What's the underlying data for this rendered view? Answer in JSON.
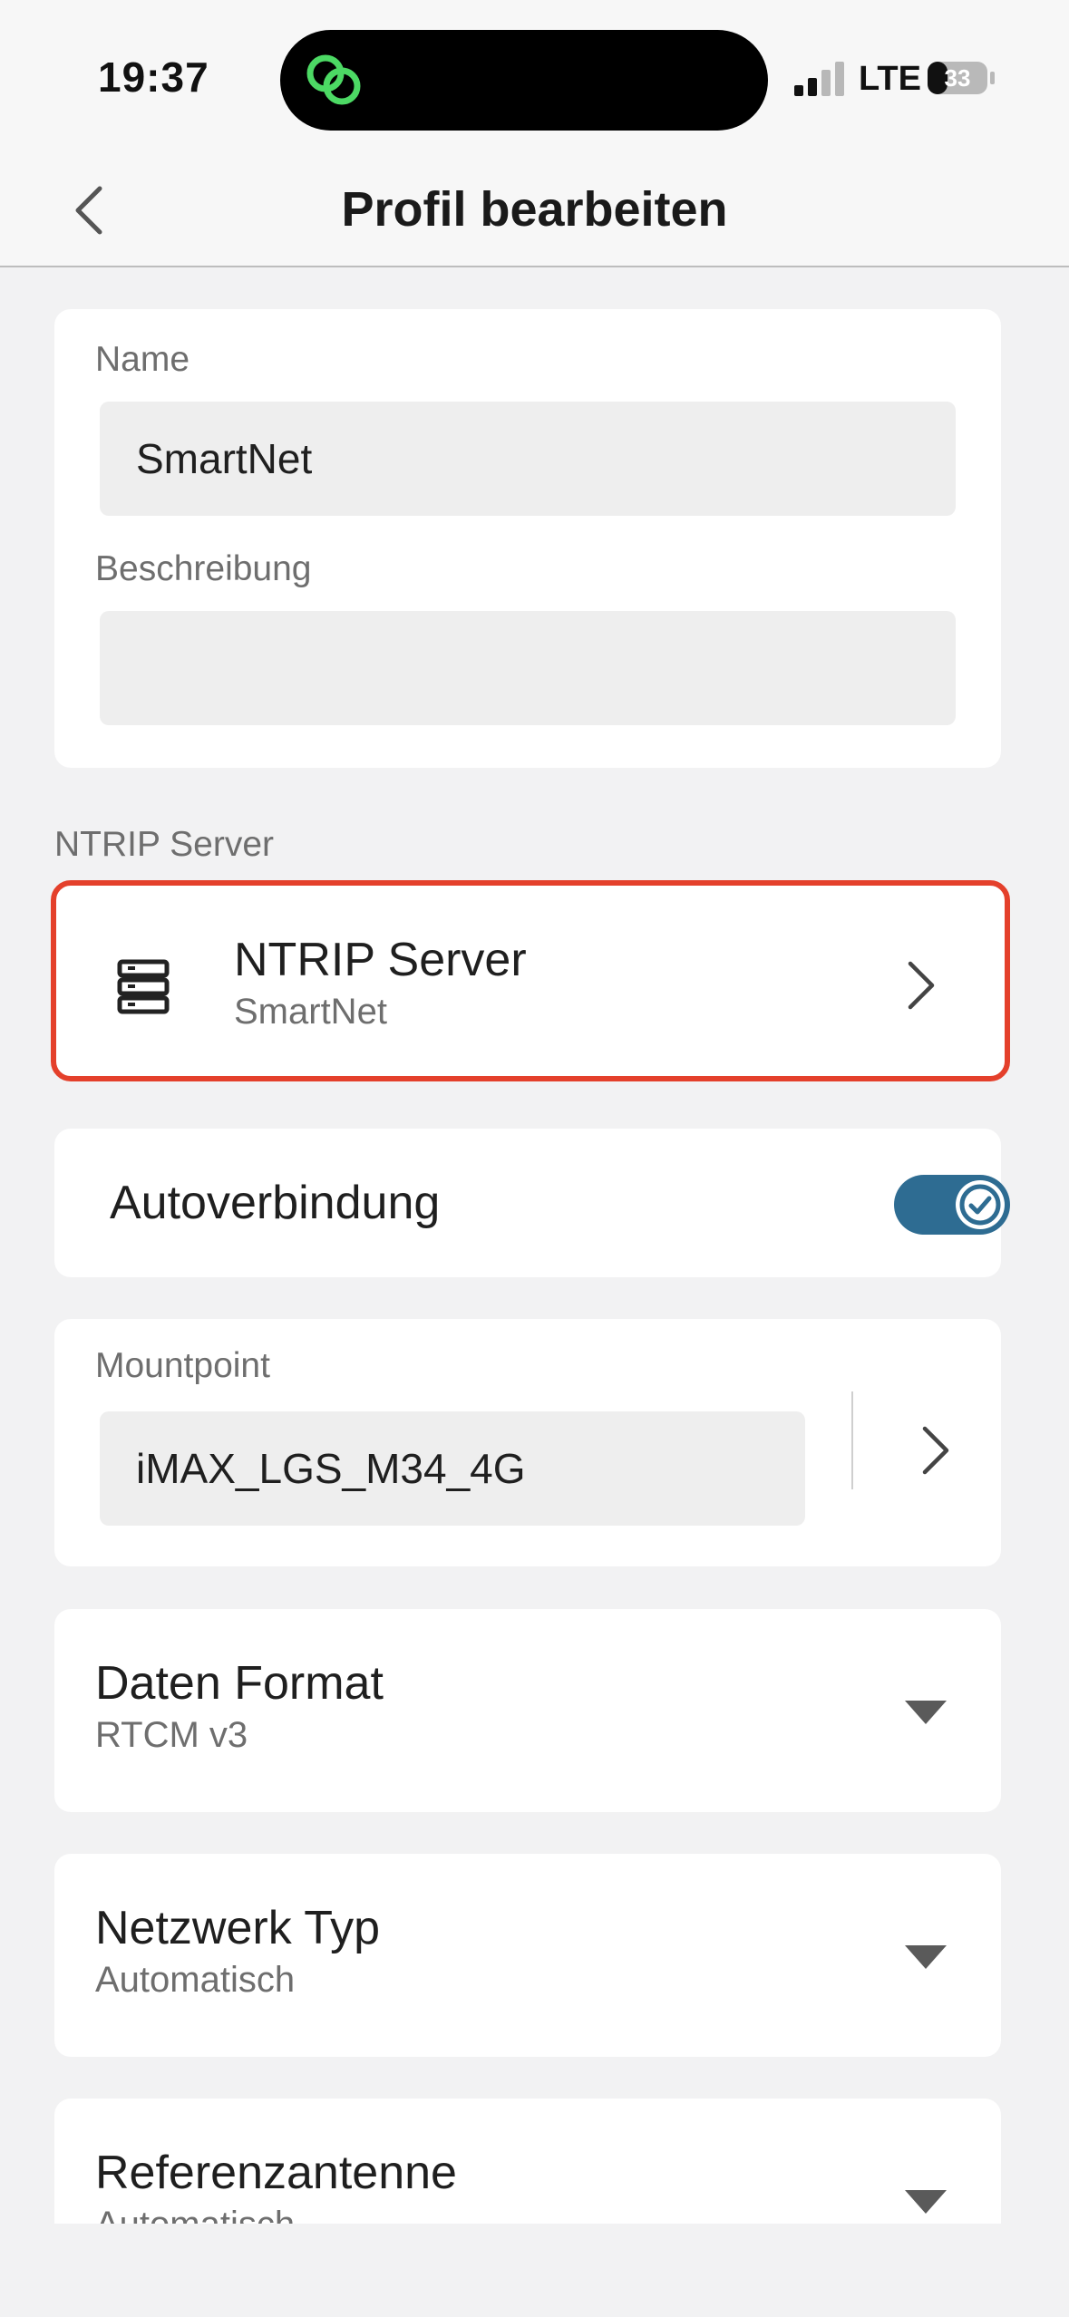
{
  "status_bar": {
    "time": "19:37",
    "network": "LTE",
    "battery": "33"
  },
  "nav": {
    "title": "Profil bearbeiten"
  },
  "profile": {
    "name_label": "Name",
    "name_value": "SmartNet",
    "description_label": "Beschreibung",
    "description_value": ""
  },
  "ntrip": {
    "section_label": "NTRIP Server",
    "title": "NTRIP Server",
    "subtitle": "SmartNet"
  },
  "autoconnect": {
    "label": "Autoverbindung",
    "enabled": true
  },
  "mountpoint": {
    "label": "Mountpoint",
    "value": "iMAX_LGS_M34_4G"
  },
  "data_format": {
    "label": "Daten Format",
    "value": "RTCM v3"
  },
  "network_type": {
    "label": "Netzwerk Typ",
    "value": "Automatisch"
  },
  "reference_antenna": {
    "label": "Referenzantenne",
    "value": "Automatisch"
  },
  "colors": {
    "accent": "#2e6c92",
    "highlight": "#e4402b",
    "background": "#f2f2f3"
  }
}
